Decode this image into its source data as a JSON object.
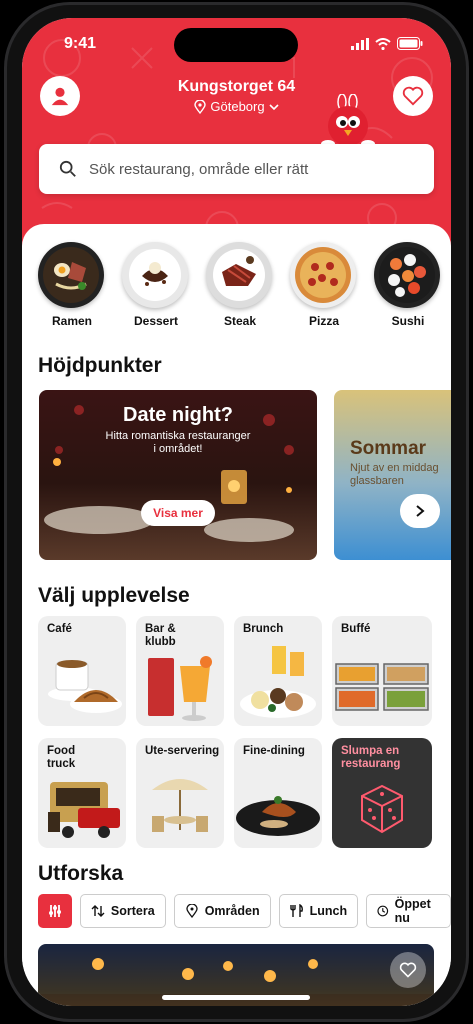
{
  "status": {
    "time": "9:41"
  },
  "header": {
    "street": "Kungstorget 64",
    "city": "Göteborg"
  },
  "search": {
    "placeholder": "Sök restaurang, område eller rätt"
  },
  "categories": [
    {
      "label": "Ramen"
    },
    {
      "label": "Dessert"
    },
    {
      "label": "Steak"
    },
    {
      "label": "Pizza"
    },
    {
      "label": "Sushi"
    }
  ],
  "highlights": {
    "title": "Höjdpunkter",
    "cards": [
      {
        "title": "Date night?",
        "subtitle": "Hitta romantiska restauranger i området!",
        "button": "Visa mer"
      },
      {
        "title": "Sommar",
        "subtitle": "Njut av en middag glassbaren"
      }
    ]
  },
  "experience": {
    "title": "Välj upplevelse",
    "items": [
      {
        "label": "Café"
      },
      {
        "label": "Bar & klubb"
      },
      {
        "label": "Brunch"
      },
      {
        "label": "Buffé"
      },
      {
        "label": "Food truck"
      },
      {
        "label": "Ute-servering"
      },
      {
        "label": "Fine-dining"
      },
      {
        "label": "Slumpa en restaurang"
      }
    ]
  },
  "explore": {
    "title": "Utforska",
    "chips": [
      {
        "label": "Sortera",
        "icon": "sort-icon"
      },
      {
        "label": "Områden",
        "icon": "location-pin-icon"
      },
      {
        "label": "Lunch",
        "icon": "cutlery-icon"
      },
      {
        "label": "Öppet nu",
        "icon": "clock-icon"
      }
    ]
  },
  "colors": {
    "brand": "#e8303e",
    "dark_card": "#333333",
    "random_text": "#ff8fa0"
  }
}
